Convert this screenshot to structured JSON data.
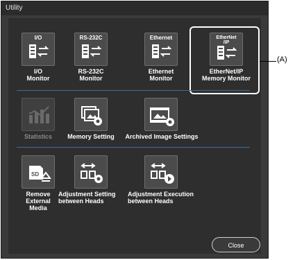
{
  "window": {
    "title": "Utility"
  },
  "monitors": [
    {
      "tile_text": "I/O",
      "label": "I/O\nMonitor"
    },
    {
      "tile_text": "RS-232C",
      "label": "RS-232C\nMonitor"
    },
    {
      "tile_text": "Ethernet",
      "label": "Ethernet\nMonitor"
    },
    {
      "tile_text": "EtherNet\n/IP",
      "label": "EtherNet/IP\nMemory Monitor"
    }
  ],
  "row2": {
    "statistics": "Statistics",
    "memory_setting": "Memory Setting",
    "archived_image_settings": "Archived Image Settings"
  },
  "row3": {
    "remove_media": "Remove\nExternal\nMedia",
    "adjust_setting": "Adjustment Setting\nbetween Heads",
    "adjust_execution": "Adjustment Execution\nbetween Heads",
    "sd_text": "SD"
  },
  "close_label": "Close",
  "callout_label": "(A)",
  "colors": {
    "panel": "#2e2e2e",
    "separator": "#3f6f9a",
    "disabled": "#8a8a8a"
  }
}
